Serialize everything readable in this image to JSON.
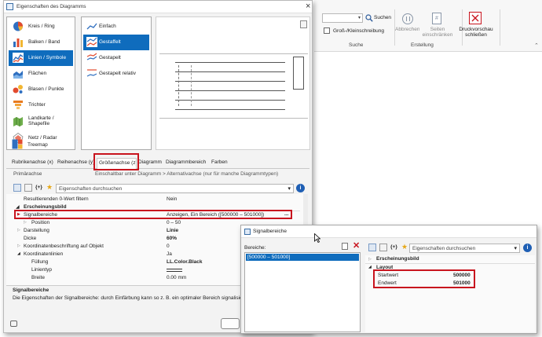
{
  "ribbon": {
    "search_label": "Suchen",
    "case_label": "Groß-/Kleinschreibung",
    "search_group": "Suche",
    "cancel_label": "Abbrechen",
    "pages_label": "Seiten einschränken",
    "create_group": "Erstellung",
    "close_preview_line1": "Druckvorschau",
    "close_preview_line2": "schließen"
  },
  "dialog": {
    "title": "Eigenschaften des Diagramms",
    "close_glyph": "×",
    "chart_types": [
      {
        "label": "Kreis / Ring",
        "icon": "pie-chart-icon"
      },
      {
        "label": "Balken / Band",
        "icon": "bar-chart-icon"
      },
      {
        "label": "Linien / Symbole",
        "icon": "line-chart-icon",
        "selected": true
      },
      {
        "label": "Flächen",
        "icon": "area-chart-icon"
      },
      {
        "label": "Blasen / Punkte",
        "icon": "bubble-chart-icon"
      },
      {
        "label": "Trichter",
        "icon": "funnel-chart-icon"
      },
      {
        "label": "Landkarte / Shapefile",
        "icon": "map-chart-icon"
      },
      {
        "label": "Netz / Radar",
        "icon": "radar-chart-icon"
      },
      {
        "label": "Treemap",
        "icon": "treemap-chart-icon"
      }
    ],
    "subtypes": [
      {
        "label": "Einfach"
      },
      {
        "label": "Gestaffelt",
        "selected": true
      },
      {
        "label": "Gestapelt"
      },
      {
        "label": "Gestapelt relativ"
      }
    ],
    "tabs": [
      {
        "label": "Rubrikenachse (x)"
      },
      {
        "label": "Reihenachse (y)"
      },
      {
        "label": "Größenachse (z)",
        "active": true
      },
      {
        "label": "Diagramm"
      },
      {
        "label": "Diagrammbereich"
      },
      {
        "label": "Farben"
      }
    ],
    "section_label": "Primärachse",
    "hint": "Einschaltbar unter Diagramm > Alternativachse (nur für manche Diagrammtypen)",
    "search_placeholder": "Eigenschaften durchsuchen",
    "properties": [
      {
        "key": "Resultierenden 0-Wert filtern",
        "value": "Nein"
      },
      {
        "key": "Erscheinungsbild",
        "value": "",
        "group": true
      },
      {
        "key": "Signalbereiche",
        "value": "Anzeigen, Ein Bereich ([500000 – 501000])",
        "highlight": true
      },
      {
        "key": "Position",
        "value": "0 – 50",
        "indent": 1
      },
      {
        "key": "Darstellung",
        "value": "Linie",
        "bold": true
      },
      {
        "key": "Dicke",
        "value": "60%",
        "bold": true
      },
      {
        "key": "Koordinatenbeschriftung auf Objekt",
        "value": "0"
      },
      {
        "key": "Koordinatenlinien",
        "value": "Ja"
      },
      {
        "key": "Füllung",
        "value": "LL.Color.Black",
        "indent": 1,
        "bold": true
      },
      {
        "key": "Linientyp",
        "value": "",
        "indent": 1
      },
      {
        "key": "Breite",
        "value": "0.00 mm",
        "indent": 1
      }
    ],
    "desc_title": "Signalbereiche",
    "desc_text": "Die Eigenschaften der Signalbereiche: durch Einfärbung kann so z. B. ein optimaler Bereich signalisiert werden.",
    "ellipsis": "..."
  },
  "popup": {
    "title": "Signalbereiche",
    "areas_label": "Bereiche:",
    "area_item": "[500000 – 501000]",
    "search_placeholder": "Eigenschaften durchsuchen",
    "group_appearance": "Erscheinungsbild",
    "group_layout": "Layout",
    "start_key": "Startwert",
    "start_value": "500000",
    "end_key": "Endwert",
    "end_value": "501000"
  }
}
